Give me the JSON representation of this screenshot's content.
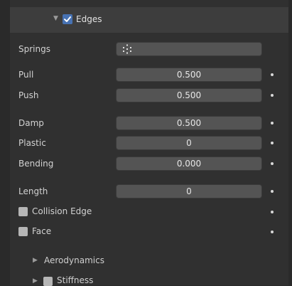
{
  "edges_panel": {
    "title": "Edges",
    "enabled": true,
    "springs": {
      "label": "Springs",
      "value": ""
    },
    "pull": {
      "label": "Pull",
      "value": "0.500"
    },
    "push": {
      "label": "Push",
      "value": "0.500"
    },
    "damp": {
      "label": "Damp",
      "value": "0.500"
    },
    "plastic": {
      "label": "Plastic",
      "value": "0"
    },
    "bending": {
      "label": "Bending",
      "value": "0.000"
    },
    "length": {
      "label": "Length",
      "value": "0"
    },
    "collision_edge": {
      "label": "Collision Edge",
      "checked": false
    },
    "face": {
      "label": "Face",
      "checked": false
    }
  },
  "subpanels": {
    "aerodynamics": {
      "label": "Aerodynamics",
      "expanded": false
    },
    "stiffness": {
      "label": "Stiffness",
      "expanded": false,
      "enabled": false
    }
  },
  "colors": {
    "checkbox_on": "#4772b3",
    "field_bg": "#545454",
    "panel_bg": "#303030",
    "header_bg": "#3d3d3d"
  }
}
